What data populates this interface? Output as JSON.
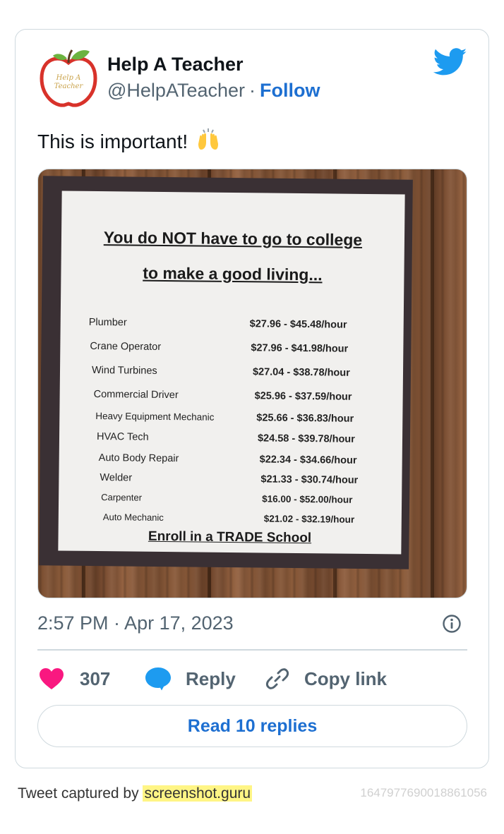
{
  "author": {
    "name": "Help A Teacher",
    "handle": "@HelpATeacher",
    "separator": "·",
    "follow_label": "Follow",
    "avatar_text_line1": "Help A",
    "avatar_text_line2": "Teacher"
  },
  "tweet": {
    "text": "This is important!",
    "emoji": "raising-hands-emoji",
    "timestamp": "2:57 PM · Apr 17, 2023"
  },
  "sign": {
    "heading_line1": "You do NOT have to go to college",
    "heading_line2": "to make a good living...",
    "rows": [
      {
        "job": "Plumber",
        "pay": "$27.96 - $45.48/hour"
      },
      {
        "job": "Crane Operator",
        "pay": "$27.96 - $41.98/hour"
      },
      {
        "job": "Wind Turbines",
        "pay": "$27.04 - $38.78/hour"
      },
      {
        "job": "Commercial Driver",
        "pay": "$25.96 - $37.59/hour"
      },
      {
        "job": "Heavy Equipment Mechanic",
        "pay": "$25.66 - $36.83/hour"
      },
      {
        "job": "HVAC Tech",
        "pay": "$24.58 - $39.78/hour"
      },
      {
        "job": "Auto Body Repair",
        "pay": "$22.34 - $34.66/hour"
      },
      {
        "job": "Welder",
        "pay": "$21.33 - $30.74/hour"
      },
      {
        "job": "Carpenter",
        "pay": "$16.00 - $52.00/hour"
      },
      {
        "job": "Auto Mechanic",
        "pay": "$21.02 - $32.19/hour"
      }
    ],
    "footer": "Enroll in a TRADE School"
  },
  "actions": {
    "like_count": "307",
    "reply_label": "Reply",
    "copy_label": "Copy link",
    "read_replies_label": "Read 10 replies"
  },
  "footer": {
    "captured_prefix": "Tweet captured by",
    "brand": "screenshot.guru",
    "tweet_id": "1647977690018861056"
  },
  "colors": {
    "link_blue": "#1d6fd1",
    "twitter_blue": "#1d9bf0",
    "like_pink": "#f91880",
    "muted_gray": "#536471",
    "border": "#cfd9de",
    "highlight": "#fff585"
  }
}
